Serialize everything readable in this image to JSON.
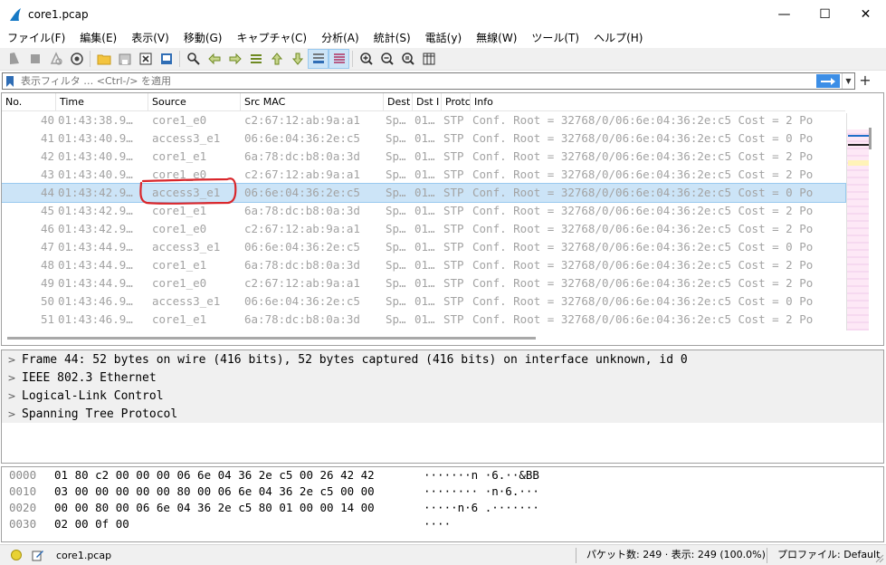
{
  "window": {
    "title": "core1.pcap",
    "controls": {
      "minimize": "—",
      "maximize": "☐",
      "close": "✕"
    }
  },
  "menu": [
    "ファイル(F)",
    "編集(E)",
    "表示(V)",
    "移動(G)",
    "キャプチャ(C)",
    "分析(A)",
    "統計(S)",
    "電話(y)",
    "無線(W)",
    "ツール(T)",
    "ヘルプ(H)"
  ],
  "toolbar": {
    "icons": [
      "start-capture-icon",
      "stop-capture-icon",
      "restart-capture-icon",
      "capture-options-icon",
      "open-file-icon",
      "save-file-icon",
      "close-file-icon",
      "reload-file-icon",
      "find-packet-icon",
      "go-back-icon",
      "go-forward-icon",
      "go-to-packet-icon",
      "go-first-icon",
      "go-last-icon",
      "auto-scroll-icon",
      "colorize-icon",
      "zoom-in-icon",
      "zoom-out-icon",
      "zoom-normal-icon",
      "resize-columns-icon"
    ]
  },
  "filter": {
    "placeholder": "表示フィルタ … <Ctrl-/> を適用",
    "value": ""
  },
  "packet_list": {
    "columns": [
      "No.",
      "Time",
      "Source",
      "Src MAC",
      "Dest",
      "Dst I",
      "Protc",
      "Info"
    ],
    "rows": [
      {
        "no": "40",
        "time": "01:43:38.9…",
        "source": "core1_e0",
        "src_mac": "c2:67:12:ab:9a:a1",
        "dest": "Sp…",
        "dst_i": "01…",
        "proto": "STP",
        "info": "Conf. Root = 32768/0/06:6e:04:36:2e:c5   Cost = 2  Po"
      },
      {
        "no": "41",
        "time": "01:43:40.9…",
        "source": "access3_e1",
        "src_mac": "06:6e:04:36:2e:c5",
        "dest": "Sp…",
        "dst_i": "01…",
        "proto": "STP",
        "info": "Conf. Root = 32768/0/06:6e:04:36:2e:c5   Cost = 0  Po"
      },
      {
        "no": "42",
        "time": "01:43:40.9…",
        "source": "core1_e1",
        "src_mac": "6a:78:dc:b8:0a:3d",
        "dest": "Sp…",
        "dst_i": "01…",
        "proto": "STP",
        "info": "Conf. Root = 32768/0/06:6e:04:36:2e:c5   Cost = 2  Po"
      },
      {
        "no": "43",
        "time": "01:43:40.9…",
        "source": "core1_e0",
        "src_mac": "c2:67:12:ab:9a:a1",
        "dest": "Sp…",
        "dst_i": "01…",
        "proto": "STP",
        "info": "Conf. Root = 32768/0/06:6e:04:36:2e:c5   Cost = 2  Po"
      },
      {
        "no": "44",
        "time": "01:43:42.9…",
        "source": "access3_e1",
        "src_mac": "06:6e:04:36:2e:c5",
        "dest": "Sp…",
        "dst_i": "01…",
        "proto": "STP",
        "info": "Conf. Root = 32768/0/06:6e:04:36:2e:c5   Cost = 0  Po"
      },
      {
        "no": "45",
        "time": "01:43:42.9…",
        "source": "core1_e1",
        "src_mac": "6a:78:dc:b8:0a:3d",
        "dest": "Sp…",
        "dst_i": "01…",
        "proto": "STP",
        "info": "Conf. Root = 32768/0/06:6e:04:36:2e:c5   Cost = 2  Po"
      },
      {
        "no": "46",
        "time": "01:43:42.9…",
        "source": "core1_e0",
        "src_mac": "c2:67:12:ab:9a:a1",
        "dest": "Sp…",
        "dst_i": "01…",
        "proto": "STP",
        "info": "Conf. Root = 32768/0/06:6e:04:36:2e:c5   Cost = 2  Po"
      },
      {
        "no": "47",
        "time": "01:43:44.9…",
        "source": "access3_e1",
        "src_mac": "06:6e:04:36:2e:c5",
        "dest": "Sp…",
        "dst_i": "01…",
        "proto": "STP",
        "info": "Conf. Root = 32768/0/06:6e:04:36:2e:c5   Cost = 0  Po"
      },
      {
        "no": "48",
        "time": "01:43:44.9…",
        "source": "core1_e1",
        "src_mac": "6a:78:dc:b8:0a:3d",
        "dest": "Sp…",
        "dst_i": "01…",
        "proto": "STP",
        "info": "Conf. Root = 32768/0/06:6e:04:36:2e:c5   Cost = 2  Po"
      },
      {
        "no": "49",
        "time": "01:43:44.9…",
        "source": "core1_e0",
        "src_mac": "c2:67:12:ab:9a:a1",
        "dest": "Sp…",
        "dst_i": "01…",
        "proto": "STP",
        "info": "Conf. Root = 32768/0/06:6e:04:36:2e:c5   Cost = 2  Po"
      },
      {
        "no": "50",
        "time": "01:43:46.9…",
        "source": "access3_e1",
        "src_mac": "06:6e:04:36:2e:c5",
        "dest": "Sp…",
        "dst_i": "01…",
        "proto": "STP",
        "info": "Conf. Root = 32768/0/06:6e:04:36:2e:c5   Cost = 0  Po"
      },
      {
        "no": "51",
        "time": "01:43:46.9…",
        "source": "core1_e1",
        "src_mac": "6a:78:dc:b8:0a:3d",
        "dest": "Sp…",
        "dst_i": "01…",
        "proto": "STP",
        "info": "Conf. Root = 32768/0/06:6e:04:36:2e:c5   Cost = 2  Po"
      }
    ],
    "selected_no": "44"
  },
  "details": [
    "Frame 44: 52 bytes on wire (416 bits), 52 bytes captured (416 bits) on interface unknown, id 0",
    "IEEE 802.3 Ethernet",
    "Logical-Link Control",
    "Spanning Tree Protocol"
  ],
  "bytes": [
    {
      "offset": "0000",
      "hex": "01 80 c2 00 00 00 06 6e  04 36 2e c5 00 26 42 42",
      "ascii": "·······n ·6.··&BB"
    },
    {
      "offset": "0010",
      "hex": "03 00 00 00 00 00 80 00  06 6e 04 36 2e c5 00 00",
      "ascii": "········ ·n·6.···"
    },
    {
      "offset": "0020",
      "hex": "00 00 80 00 06 6e 04 36  2e c5 80 01 00 00 14 00",
      "ascii": "·····n·6 .·······"
    },
    {
      "offset": "0030",
      "hex": "02 00 0f 00",
      "ascii": "····"
    }
  ],
  "status": {
    "file": "core1.pcap",
    "packets": "パケット数: 249 · 表示: 249 (100.0%)",
    "profile": "プロファイル: Default"
  },
  "colors": {
    "selected_row": "#cce4f7",
    "annotation": "#d9262b",
    "filter_apply": "#3c8ee6",
    "status_led": "#e8d233"
  }
}
